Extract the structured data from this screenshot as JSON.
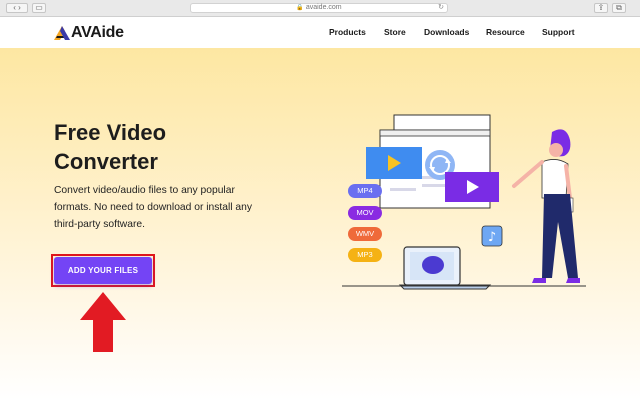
{
  "browser": {
    "url": "avaide.com"
  },
  "nav": {
    "brand": "AVAide",
    "items": [
      "Products",
      "Store",
      "Downloads",
      "Resource",
      "Support"
    ]
  },
  "hero": {
    "title_line1": "Free Video",
    "title_line2": "Converter",
    "description": "Convert video/audio files to any popular formats. No need to download or install any third-party software.",
    "cta_label": "ADD YOUR FILES"
  },
  "illustration": {
    "formats": [
      {
        "label": "MP4",
        "color": "#6a6ff0"
      },
      {
        "label": "MOV",
        "color": "#8a2be2"
      },
      {
        "label": "WMV",
        "color": "#ef6a3a"
      },
      {
        "label": "MP3",
        "color": "#f5b214"
      }
    ]
  },
  "colors": {
    "accent": "#7444f5",
    "highlight_border": "#e0161d",
    "arrow": "#e21b23"
  }
}
